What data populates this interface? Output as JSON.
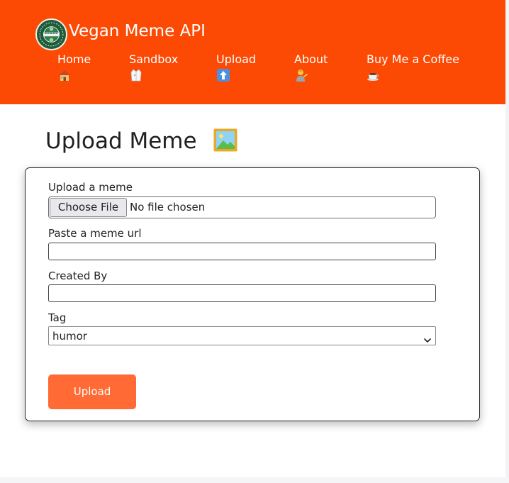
{
  "header": {
    "brand": "Vegan Meme API",
    "logo_icon": "vegan-seal-logo",
    "background": "#fc4a04"
  },
  "nav": {
    "items": [
      {
        "label": "Home",
        "icon": "house-icon"
      },
      {
        "label": "Sandbox",
        "icon": "lab-coat-icon"
      },
      {
        "label": "Upload",
        "icon": "up-arrow-icon"
      },
      {
        "label": "About",
        "icon": "person-tipping-hand-icon"
      },
      {
        "label": "Buy Me a Coffee",
        "icon": "coffee-icon"
      }
    ]
  },
  "main": {
    "title": "Upload Meme",
    "title_icon": "framed-picture-icon"
  },
  "form": {
    "upload_label": "Upload a meme",
    "file_button": "Choose File",
    "file_status": "No file chosen",
    "url_label": "Paste a meme url",
    "url_value": "",
    "created_by_label": "Created By",
    "created_by_value": "",
    "tag_label": "Tag",
    "tag_selected": "humor",
    "submit_label": "Upload",
    "submit_color": "#ff6a35"
  }
}
